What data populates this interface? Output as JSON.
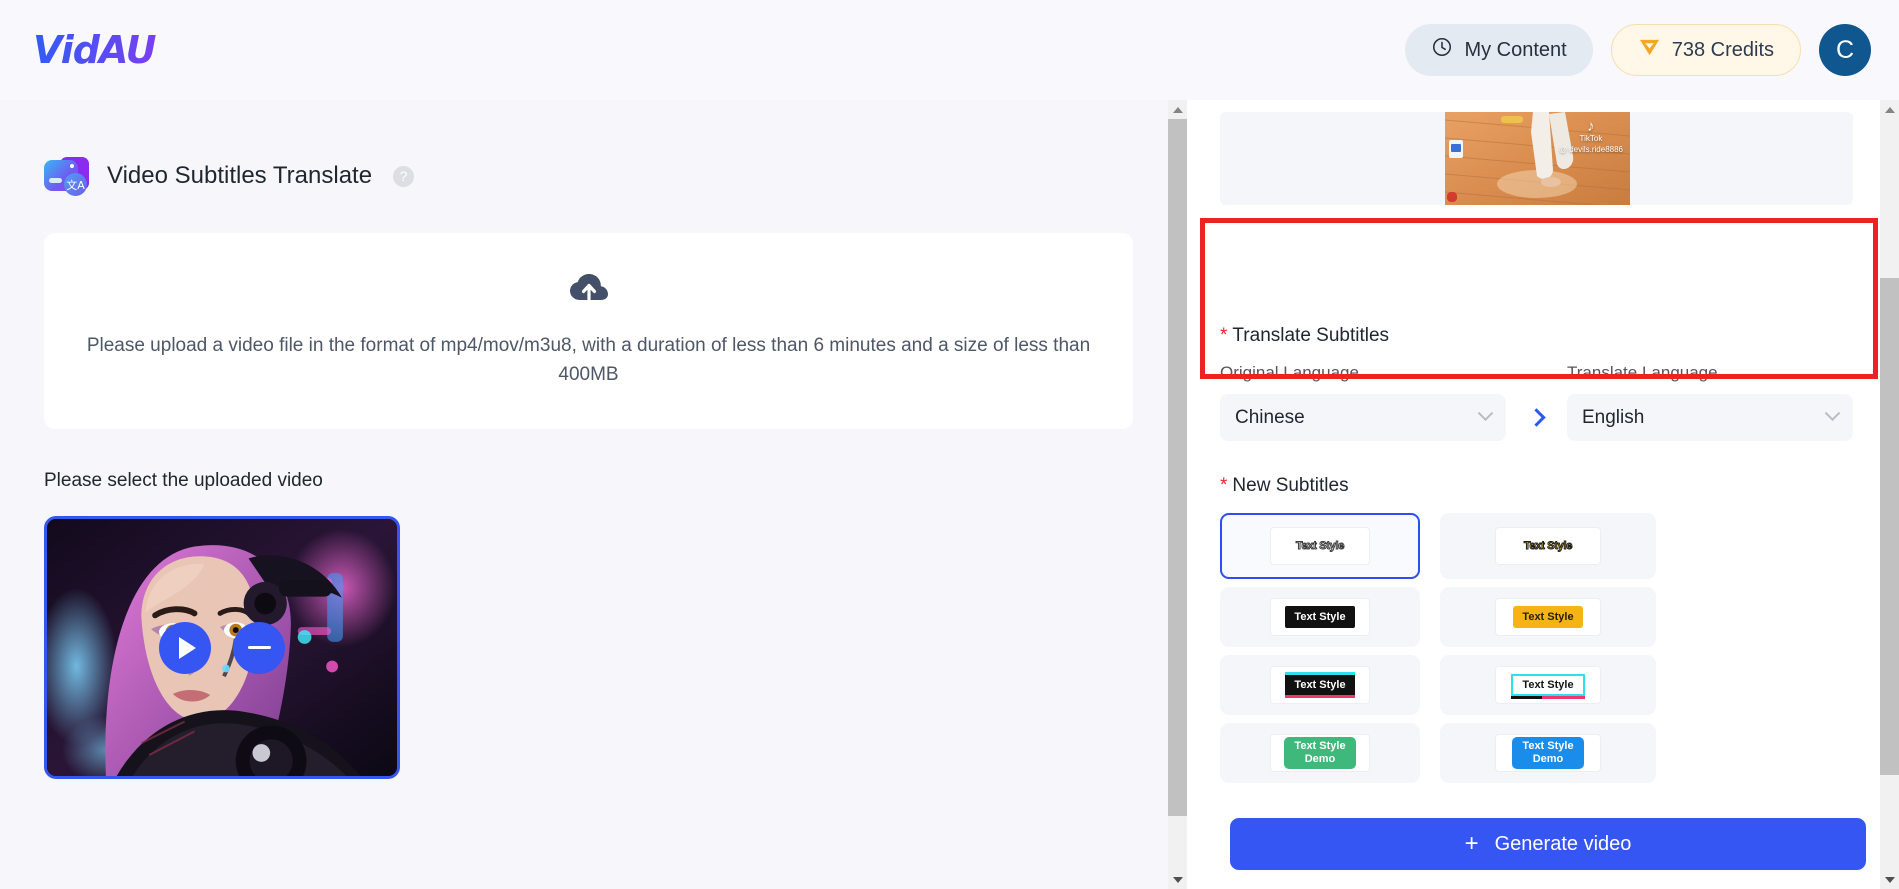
{
  "header": {
    "logo": "VidAU",
    "my_content_label": "My Content",
    "my_content_icon": "clock-icon",
    "credits_label": "738 Credits",
    "credits_icon": "diamond-gem-icon",
    "avatar_initial": "C"
  },
  "main": {
    "page_title": "Video Subtitles Translate",
    "title_icon": "video-translate-icon",
    "title_badge_glyph": "文A",
    "help_icon": "question-mark-icon",
    "upload": {
      "icon": "cloud-upload-icon",
      "text": "Please upload a video file in the format of mp4/mov/m3u8, with a duration of less than 6 minutes and a size of less than 400MB"
    },
    "select_video_label": "Please select the uploaded video",
    "thumbnail": {
      "name": "cyberpunk-portrait-thumbnail",
      "play_icon": "play-icon",
      "remove_icon": "minus-icon"
    }
  },
  "panel": {
    "preview": {
      "watermark_label": "TikTok",
      "watermark_user": "@ devils.ride8886",
      "music_glyph": "♪"
    },
    "translate": {
      "section_label": "Translate Subtitles",
      "required_star": "*",
      "original_caption": "Original Language",
      "original_value": "Chinese",
      "translate_caption": "Translate Language",
      "translate_value": "English",
      "arrow_icon": "chevron-right-icon",
      "dropdown_icon": "chevron-down-icon"
    },
    "subtitles": {
      "section_label": "New Subtitles",
      "required_star": "*",
      "styles": [
        {
          "id": "style-outline-white",
          "label": "Text Style",
          "selected": true
        },
        {
          "id": "style-outline-yellow",
          "label": "Text Style",
          "selected": false
        },
        {
          "id": "style-black-box",
          "label": "Text Style",
          "selected": false
        },
        {
          "id": "style-yellow-box",
          "label": "Text Style",
          "selected": false
        },
        {
          "id": "style-black-cyan-pink",
          "label": "Text Style",
          "selected": false
        },
        {
          "id": "style-white-cyan-border",
          "label": "Text Style",
          "selected": false
        },
        {
          "id": "style-green-bubble",
          "label": "Text Style\nDemo",
          "line1": "Text Style",
          "line2": "Demo",
          "selected": false
        },
        {
          "id": "style-blue-bubble",
          "label": "Text Style\nDemo",
          "line1": "Text Style",
          "line2": "Demo",
          "selected": false
        }
      ]
    },
    "generate_button": {
      "label": "Generate video",
      "plus_icon": "plus-icon",
      "plus_glyph": "+"
    }
  },
  "colors": {
    "accent_blue": "#3556f2",
    "annotation_red": "#ee2222",
    "credits_amber": "#f5a623",
    "avatar_blue": "#10568f"
  }
}
